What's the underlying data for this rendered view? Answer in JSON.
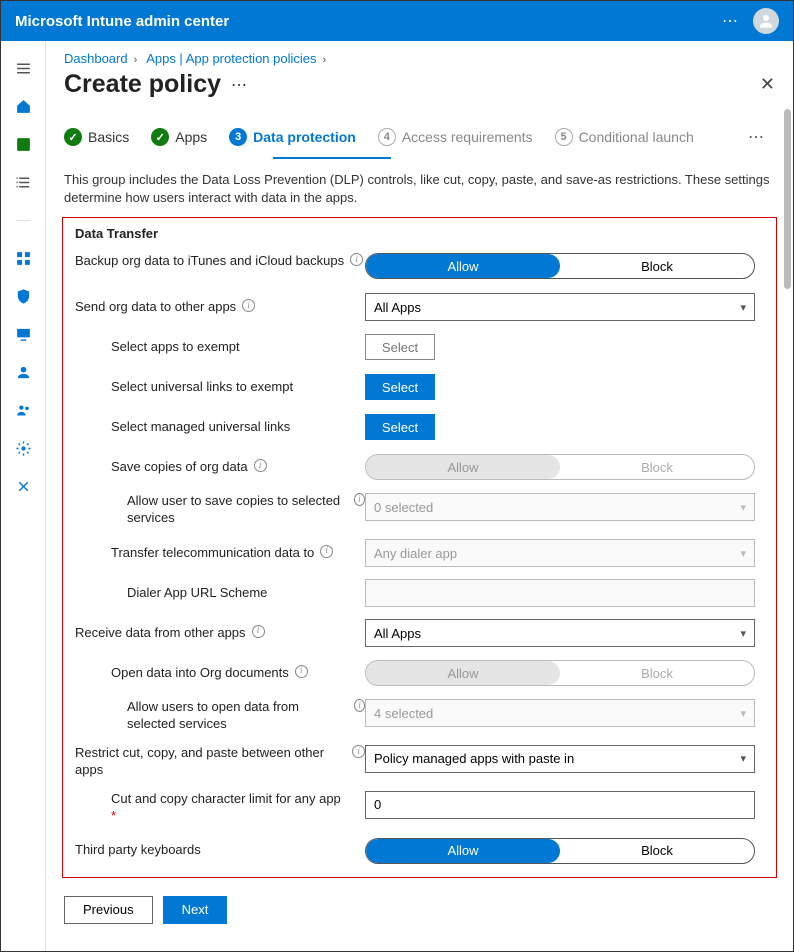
{
  "header": {
    "title": "Microsoft Intune admin center"
  },
  "breadcrumbs": [
    "Dashboard",
    "Apps | App protection policies"
  ],
  "page_title": "Create policy",
  "steps": {
    "s1": "Basics",
    "s2": "Apps",
    "s3": "Data protection",
    "s4": "Access requirements",
    "s5": "Conditional launch",
    "n3": "3",
    "n4": "4",
    "n5": "5"
  },
  "description": "This group includes the Data Loss Prevention (DLP) controls, like cut, copy, paste, and save-as restrictions. These settings determine how users interact with data in the apps.",
  "section_header": "Data Transfer",
  "labels": {
    "backup": "Backup org data to iTunes and iCloud backups",
    "send_other": "Send org data to other apps",
    "exempt_apps": "Select apps to exempt",
    "exempt_ulinks": "Select universal links to exempt",
    "managed_ulinks": "Select managed universal links",
    "save_copies": "Save copies of org data",
    "save_services": "Allow user to save copies to selected services",
    "telecom": "Transfer telecommunication data to",
    "dialer_scheme": "Dialer App URL Scheme",
    "receive": "Receive data from other apps",
    "open_docs": "Open data into Org documents",
    "open_services": "Allow users to open data from selected services",
    "restrict_ccp": "Restrict cut, copy, and paste between other apps",
    "char_limit": "Cut and copy character limit for any app",
    "third_party_kb": "Third party keyboards"
  },
  "values": {
    "pill_allow": "Allow",
    "pill_block": "Block",
    "all_apps": "All Apps",
    "btn_select": "Select",
    "zero_selected": "0 selected",
    "any_dialer": "Any dialer app",
    "four_selected": "4 selected",
    "paste_in": "Policy managed apps with paste in",
    "char_limit_val": "0"
  },
  "footer": {
    "prev": "Previous",
    "next": "Next"
  }
}
